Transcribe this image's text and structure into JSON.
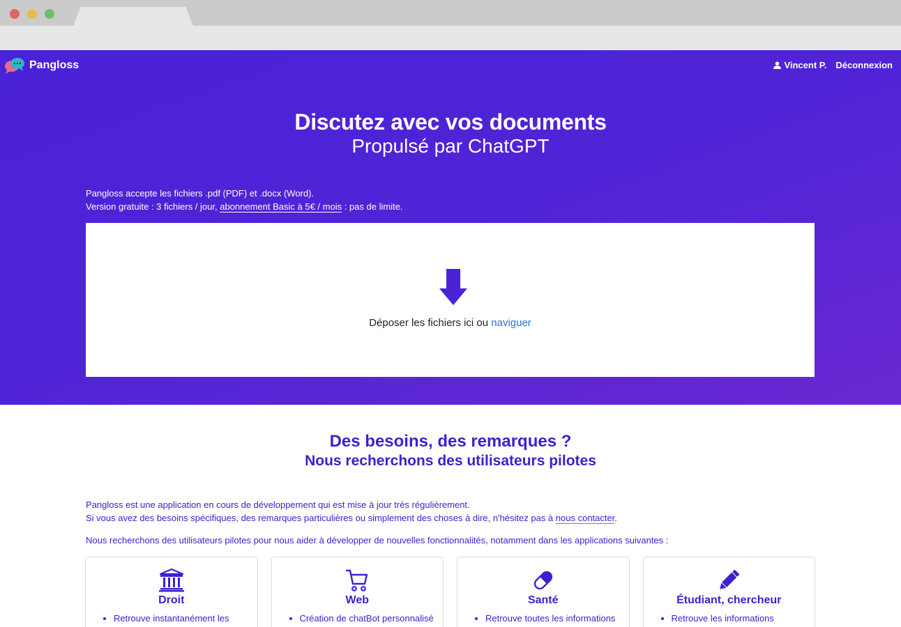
{
  "nav": {
    "brand": "Pangloss",
    "user_name": "Vincent P.",
    "logout": "Déconnexion"
  },
  "hero": {
    "title": "Discutez avec vos documents",
    "subtitle": "Propulsé par ChatGPT",
    "info_line1": "Pangloss accepte les fichiers .pdf (PDF) et .docx (Word).",
    "info_line2_prefix": "Version gratuite : 3 fichiers / jour, ",
    "info_line2_link": "abonnement Basic à 5€ / mois",
    "info_line2_suffix": " : pas de limite."
  },
  "dropzone": {
    "text": "Déposer les fichiers ici ou ",
    "browse": "naviguer"
  },
  "section": {
    "title": "Des besoins, des remarques ?",
    "subtitle": "Nous recherchons des utilisateurs pilotes",
    "p1_line1": "Pangloss est une application en cours de développement qui est mise à jour très régulièrement.",
    "p1_line2_prefix": "Si vous avez des besoins spécifiques, des remarques particulières ou simplement des choses à dire, n'hésitez pas à ",
    "p1_line2_link": "nous contacter",
    "p1_line2_suffix": ".",
    "p2": "Nous recherchons des utilisateurs pilotes pour nous aider à développer de nouvelles fonctionnalités, notamment dans les applications suivantes :"
  },
  "cards": [
    {
      "icon": "bank-icon",
      "title": "Droit",
      "item": "Retrouve instantanément les"
    },
    {
      "icon": "cart-icon",
      "title": "Web",
      "item": "Création de chatBot personnalisé"
    },
    {
      "icon": "pill-icon",
      "title": "Santé",
      "item": "Retrouve toutes les informations"
    },
    {
      "icon": "pencil-icon",
      "title": "Étudiant, chercheur",
      "item": "Retrouve les informations"
    }
  ],
  "colors": {
    "hero_start": "#4a22d8",
    "hero_end": "#6a28d2",
    "accent": "#3b22d0",
    "link": "#2b6fd8"
  }
}
